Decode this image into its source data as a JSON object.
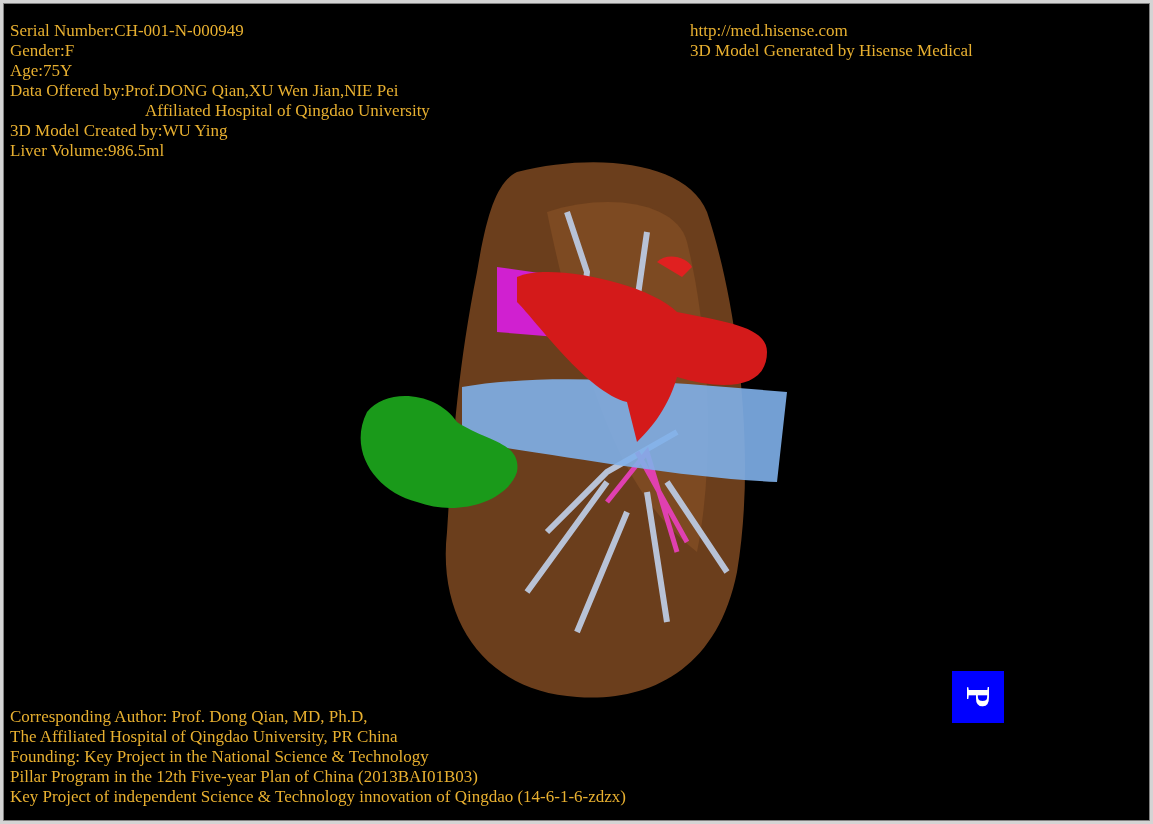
{
  "info_top_left": [
    {
      "text": "Serial Number:CH-001-N-000949",
      "indented": false
    },
    {
      "text": "Gender:F",
      "indented": false
    },
    {
      "text": "Age:75Y",
      "indented": false
    },
    {
      "text": "Data Offered by:Prof.DONG Qian,XU Wen Jian,NIE Pei",
      "indented": false
    },
    {
      "text": "Affiliated Hospital of Qingdao University",
      "indented": true
    },
    {
      "text": "3D Model Created by:WU Ying",
      "indented": false
    },
    {
      "text": "Liver Volume:986.5ml",
      "indented": false
    }
  ],
  "info_top_right": [
    "http://med.hisense.com",
    "3D Model Generated by Hisense Medical"
  ],
  "orientation_marker": "P",
  "info_bottom": [
    "Corresponding Author: Prof. Dong Qian, MD, Ph.D,",
    "The Affiliated Hospital of Qingdao University, PR China",
    "Founding: Key Project in the National Science & Technology",
    "Pillar Program in the 12th Five-year Plan of China (2013BAI01B03)",
    "Key Project of independent Science & Technology innovation of Qingdao (14-6-1-6-zdzx)"
  ]
}
